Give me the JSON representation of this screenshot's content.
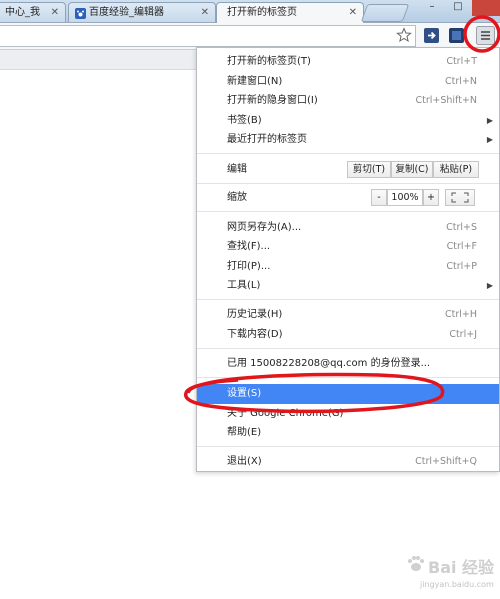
{
  "tabs": [
    {
      "title": "中心_我",
      "close": "✕"
    },
    {
      "title": "百度经验_编辑器",
      "close": "✕"
    },
    {
      "title": "打开新的标签页",
      "close": "✕"
    }
  ],
  "window_controls": {
    "minimize": "–",
    "maximize": "□"
  },
  "colors": {
    "highlight": "#4285f4",
    "annotation": "#e0161c"
  },
  "menu": {
    "new_tab": {
      "label": "打开新的标签页(T)",
      "shortcut": "Ctrl+T"
    },
    "new_window": {
      "label": "新建窗口(N)",
      "shortcut": "Ctrl+N"
    },
    "incognito": {
      "label": "打开新的隐身窗口(I)",
      "shortcut": "Ctrl+Shift+N"
    },
    "bookmarks": {
      "label": "书签(B)"
    },
    "recent_tabs": {
      "label": "最近打开的标签页"
    },
    "edit": {
      "label": "编辑",
      "cut": "剪切(T)",
      "copy": "复制(C)",
      "paste": "粘贴(P)"
    },
    "zoom": {
      "label": "缩放",
      "minus": "-",
      "value": "100%",
      "plus": "+"
    },
    "save_as": {
      "label": "网页另存为(A)...",
      "shortcut": "Ctrl+S"
    },
    "find": {
      "label": "查找(F)...",
      "shortcut": "Ctrl+F"
    },
    "print": {
      "label": "打印(P)...",
      "shortcut": "Ctrl+P"
    },
    "tools": {
      "label": "工具(L)"
    },
    "history": {
      "label": "历史记录(H)",
      "shortcut": "Ctrl+H"
    },
    "downloads": {
      "label": "下载内容(D)",
      "shortcut": "Ctrl+J"
    },
    "signed_in": {
      "label": "已用 15008228208@qq.com 的身份登录..."
    },
    "settings": {
      "label": "设置(S)"
    },
    "about": {
      "label": "关于 Google Chrome(G)"
    },
    "help": {
      "label": "帮助(E)"
    },
    "exit": {
      "label": "退出(X)",
      "shortcut": "Ctrl+Shift+Q"
    }
  },
  "watermark": {
    "brand": "Bai 经验",
    "url": "jingyan.baidu.com"
  }
}
